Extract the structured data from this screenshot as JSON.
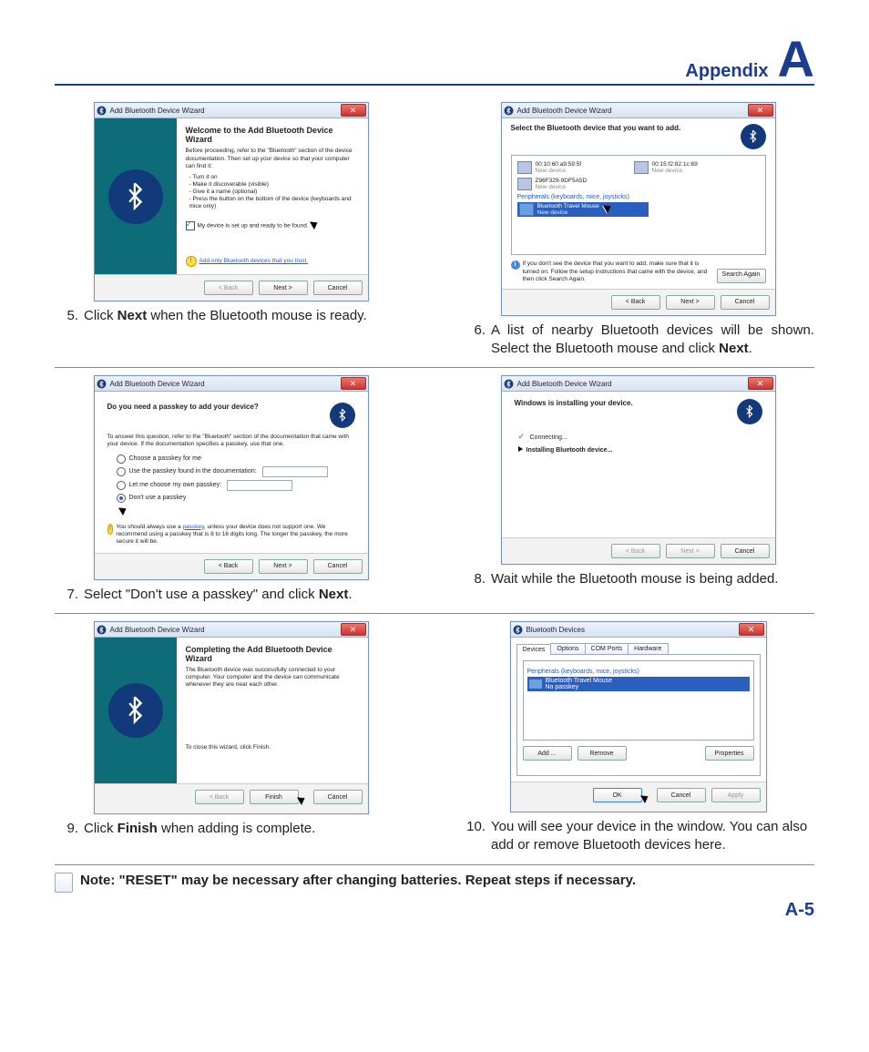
{
  "header": {
    "appendix": "Appendix",
    "letter": "A"
  },
  "page_num": "A-5",
  "wizard_title": "Add Bluetooth Device Wizard",
  "buttons": {
    "back": "< Back",
    "next": "Next >",
    "cancel": "Cancel",
    "finish": "Finish",
    "search_again": "Search Again",
    "ok": "OK",
    "apply": "Apply",
    "add": "Add ...",
    "remove": "Remove",
    "properties": "Properties"
  },
  "step5": {
    "num": "5.",
    "caption_pre": "Click ",
    "caption_bold": "Next",
    "caption_post": " when the Bluetooth mouse is ready.",
    "heading": "Welcome to the Add Bluetooth Device Wizard",
    "para": "Before proceeding, refer to the \"Bluetooth\" section of the device documentation. Then set up your device so that your computer can find it:",
    "bullets": [
      "- Turn it on",
      "- Make it discoverable (visible)",
      "- Give it a name (optional)",
      "- Press the button on the bottom of the device (keyboards and mice only)"
    ],
    "checkbox": "My device is set up and ready to be found.",
    "warn": "Add only Bluetooth devices that you trust."
  },
  "step6": {
    "num": "6.",
    "caption_pre": "A list of nearby Bluetooth devices will be shown. Select the Bluetooth mouse and click ",
    "caption_bold": "Next",
    "caption_post": ".",
    "heading": "Select the Bluetooth device that you want to add.",
    "devices": [
      {
        "name": "00:10:60:a9:59:5f",
        "sub": "New device"
      },
      {
        "name": "00:15:f2:82:1c:69",
        "sub": "New device"
      },
      {
        "name": "Z96F329-9DF5A5D",
        "sub": "New device"
      }
    ],
    "category": "Peripherals (keyboards, mice, joysticks)",
    "selected": {
      "name": "Bluetooth Travel Mouse",
      "sub": "New device"
    },
    "info": "If you don't see the device that you want to add, make sure that it is turned on. Follow the setup instructions that came with the device, and then click Search Again."
  },
  "step7": {
    "num": "7.",
    "caption_pre": "Select \"Don't use a passkey\" and click ",
    "caption_bold": "Next",
    "caption_post": ".",
    "heading": "Do you need a passkey to add your device?",
    "para": "To answer this question, refer to the \"Bluetooth\" section of the documentation that came with your device. If the documentation specifies a passkey, use that one.",
    "options": [
      "Choose a passkey for me",
      "Use the passkey found in the documentation:",
      "Let me choose my own passkey:",
      "Don't use a passkey"
    ],
    "warn_pre": "You should always use a ",
    "warn_link": "passkey",
    "warn_post": ", unless your device does not support one. We recommend using a passkey that is 8 to 16 digits long. The longer the passkey, the more secure it will be."
  },
  "step8": {
    "num": "8.",
    "caption": "Wait while the Bluetooth mouse is being added.",
    "heading": "Windows is installing your device.",
    "line1": "Connecting...",
    "line2": "Installing Bluetooth device..."
  },
  "step9": {
    "num": "9.",
    "caption_pre": "Click ",
    "caption_bold": "Finish",
    "caption_post": " when adding is complete.",
    "heading": "Completing the Add Bluetooth Device Wizard",
    "para": "The Bluetooth device was successfully connected to your computer. Your computer and the device can communicate whenever they are near each other.",
    "close_line": "To close this wizard, click Finish."
  },
  "step10": {
    "num": "10.",
    "caption": "You will see your device in the window. You can also add or remove Bluetooth devices here.",
    "title": "Bluetooth Devices",
    "tabs": [
      "Devices",
      "Options",
      "COM Ports",
      "Hardware"
    ],
    "category": "Peripherals (keyboards, mice, joysticks)",
    "selected": {
      "name": "Bluetooth Travel Mouse",
      "sub": "No passkey"
    }
  },
  "note": "Note:  \"RESET\" may be necessary after changing batteries. Repeat steps if necessary."
}
